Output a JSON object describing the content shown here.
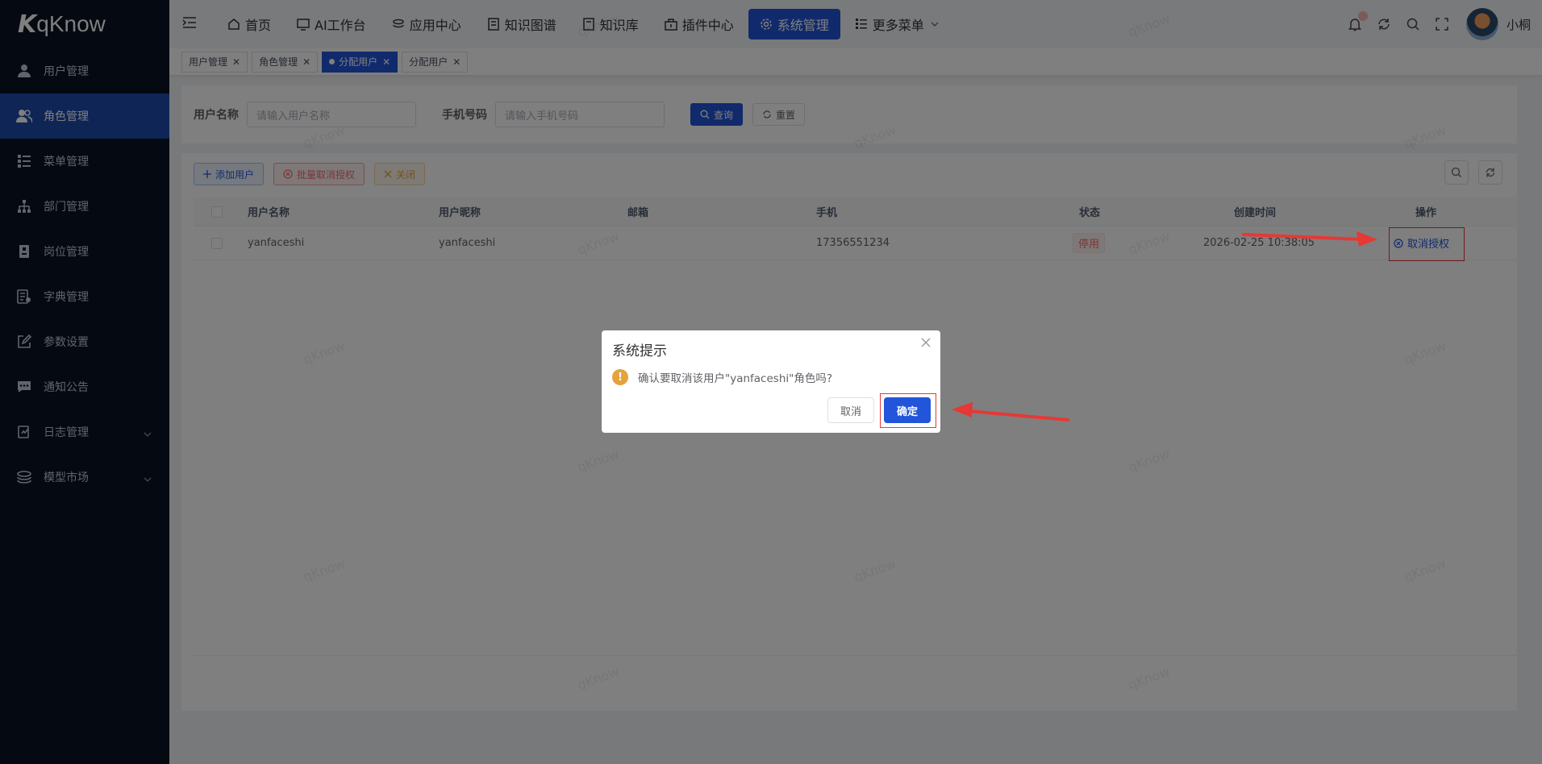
{
  "app": {
    "logo_text": "qKnow",
    "user_name": "小桐"
  },
  "sidebar": {
    "items": [
      {
        "label": "用户管理",
        "icon": "user-icon"
      },
      {
        "label": "角色管理",
        "icon": "users-icon",
        "active": true
      },
      {
        "label": "菜单管理",
        "icon": "tree-table-icon"
      },
      {
        "label": "部门管理",
        "icon": "org-tree-icon"
      },
      {
        "label": "岗位管理",
        "icon": "badge-icon"
      },
      {
        "label": "字典管理",
        "icon": "dict-icon"
      },
      {
        "label": "参数设置",
        "icon": "edit-icon"
      },
      {
        "label": "通知公告",
        "icon": "message-icon"
      },
      {
        "label": "日志管理",
        "icon": "log-icon",
        "expandable": true
      },
      {
        "label": "模型市场",
        "icon": "stack-icon",
        "expandable": true
      }
    ]
  },
  "topnav": {
    "items": [
      {
        "label": "首页"
      },
      {
        "label": "AI工作台"
      },
      {
        "label": "应用中心"
      },
      {
        "label": "知识图谱"
      },
      {
        "label": "知识库"
      },
      {
        "label": "插件中心"
      },
      {
        "label": "系统管理",
        "active": true
      },
      {
        "label": "更多菜单"
      }
    ]
  },
  "tags": [
    {
      "label": "用户管理"
    },
    {
      "label": "角色管理"
    },
    {
      "label": "分配用户",
      "active": true
    },
    {
      "label": "分配用户"
    }
  ],
  "search": {
    "username_label": "用户名称",
    "username_placeholder": "请输入用户名称",
    "phone_label": "手机号码",
    "phone_placeholder": "请输入手机号码",
    "query_label": "查询",
    "reset_label": "重置"
  },
  "toolbar": {
    "add_label": "添加用户",
    "batch_cancel_label": "批量取消授权",
    "close_label": "关闭"
  },
  "table": {
    "headers": [
      "用户名称",
      "用户昵称",
      "邮箱",
      "手机",
      "状态",
      "创建时间",
      "操作"
    ],
    "rows": [
      {
        "username": "yanfaceshi",
        "nickname": "yanfaceshi",
        "email": "",
        "phone": "17356551234",
        "status": "停用",
        "created": "2026-02-25 10:38:05",
        "action": "取消授权"
      }
    ]
  },
  "dialog": {
    "title": "系统提示",
    "message": "确认要取消该用户\"yanfaceshi\"角色吗?",
    "cancel_label": "取消",
    "confirm_label": "确定"
  },
  "watermark": "qKnow",
  "colors": {
    "primary": "#2255d9",
    "sidebar": "#0a1222",
    "danger": "#f56c6c",
    "warning": "#e6a23c",
    "annotation": "#e53935"
  }
}
